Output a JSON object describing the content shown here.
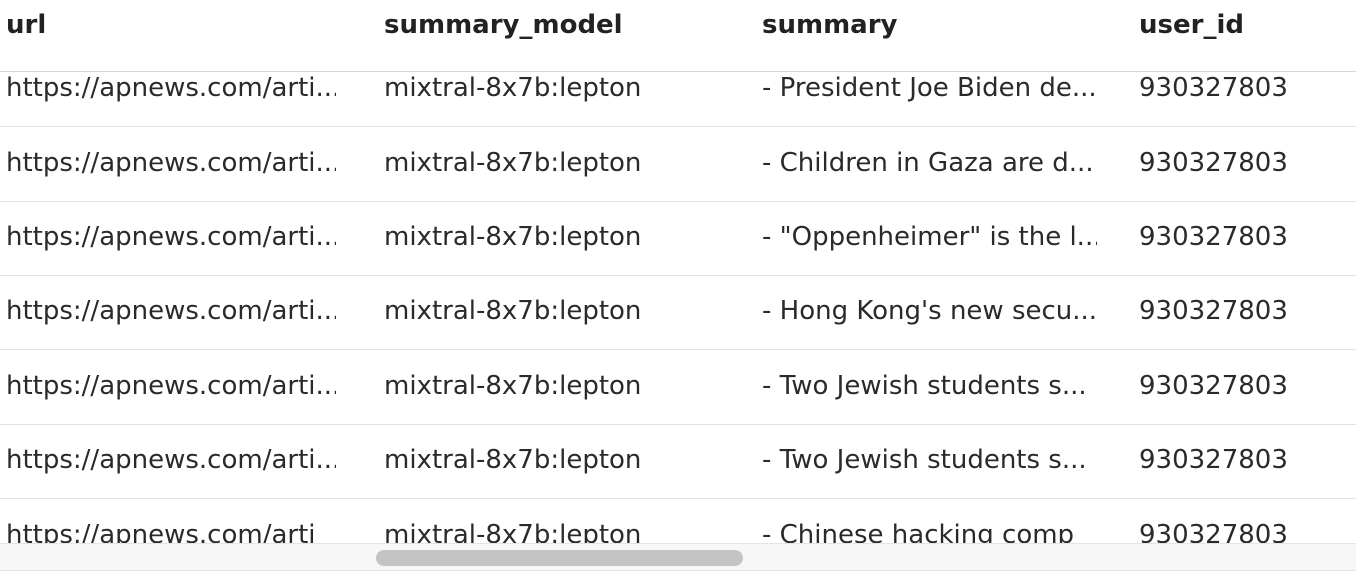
{
  "table": {
    "columns": [
      "url",
      "summary_model",
      "summary",
      "user_id"
    ],
    "rows": [
      {
        "url": "https://apnews.com/arti...",
        "summary_model": "mixtral-8x7b:lepton",
        "summary": "- President Joe Biden de...",
        "user_id": "930327803"
      },
      {
        "url": "https://apnews.com/arti...",
        "summary_model": "mixtral-8x7b:lepton",
        "summary": "- Children in Gaza are d...",
        "user_id": "930327803"
      },
      {
        "url": "https://apnews.com/arti...",
        "summary_model": "mixtral-8x7b:lepton",
        "summary": "- \"Oppenheimer\" is the l...",
        "user_id": "930327803"
      },
      {
        "url": "https://apnews.com/arti...",
        "summary_model": "mixtral-8x7b:lepton",
        "summary": "- Hong Kong's new secu...",
        "user_id": "930327803"
      },
      {
        "url": "https://apnews.com/arti...",
        "summary_model": "mixtral-8x7b:lepton",
        "summary": "- Two Jewish students s...",
        "user_id": "930327803"
      },
      {
        "url": "https://apnews.com/arti...",
        "summary_model": "mixtral-8x7b:lepton",
        "summary": "- Two Jewish students s...",
        "user_id": "930327803"
      },
      {
        "url": "https://apnews.com/arti",
        "summary_model": "mixtral-8x7b:lepton",
        "summary": "- Chinese hacking comp",
        "user_id": "930327803"
      }
    ]
  },
  "colors": {
    "header_border": "#d6d6d6",
    "row_border": "#e2e2e2",
    "scroll_thumb": "#c4c4c4"
  }
}
